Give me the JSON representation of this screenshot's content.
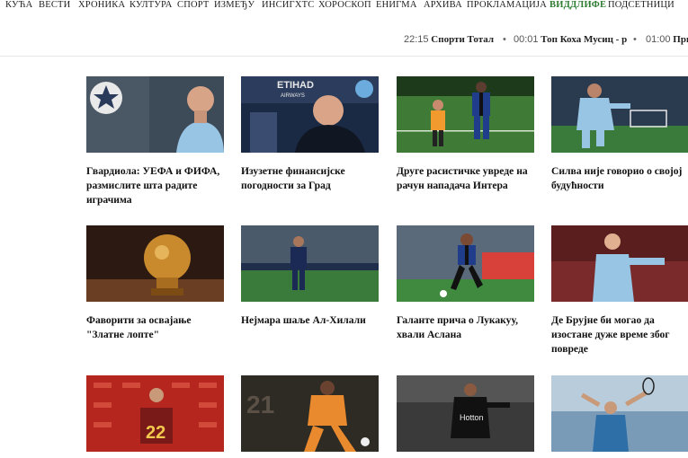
{
  "nav": {
    "items": [
      {
        "label": "КУЋА",
        "accent": false
      },
      {
        "label": "ВЕСТИ",
        "accent": false
      },
      {
        "label": "ХРОНИКА",
        "accent": false
      },
      {
        "label": "КУЛТУРА",
        "accent": false
      },
      {
        "label": "СПОРТ",
        "accent": false
      },
      {
        "label": "ИЗМЕЂУ",
        "accent": false
      },
      {
        "label": "ИНСИГХТС",
        "accent": false
      },
      {
        "label": "ХОРОСКОП",
        "accent": false
      },
      {
        "label": "ЕНИГМА",
        "accent": false
      },
      {
        "label": "АРХИВА",
        "accent": false
      },
      {
        "label": "ПРОКЛАМАЦИЈА",
        "accent": false
      },
      {
        "label": "ВИДДЛИФЕ",
        "accent": true
      },
      {
        "label": "ПОДСЕТНИЦИ",
        "accent": false
      }
    ]
  },
  "ticker": {
    "items": [
      {
        "time": "22:15",
        "title": "Спорти Тотал"
      },
      {
        "time": "00:01",
        "title": "Топ Коха Мусиц - р"
      },
      {
        "time": "01:00",
        "title": "При"
      }
    ],
    "separator": "•"
  },
  "articles": [
    {
      "caption": "Гвардиола: УЕФА и ФИФА, размислите шта радите играчима"
    },
    {
      "caption": "Изузетне финансијске погодности за Град",
      "image_text": [
        "ETIHAD",
        "AIRWAYS"
      ]
    },
    {
      "caption": "Друге расистичке увреде на рачун нападача Интера"
    },
    {
      "caption": "Силва није говорио о својој будућности"
    },
    {
      "caption": "Фаворити за освајање \"Златне лопте\""
    },
    {
      "caption": "Нејмара шаље Ал-Хилали"
    },
    {
      "caption": "Галанте прича о Лукакуу, хвали Аслана"
    },
    {
      "caption": "Де Брујне би могао да изостане дуже време због повреде"
    },
    {
      "caption": "",
      "image_text": [
        "22"
      ]
    },
    {
      "caption": "",
      "image_text": [
        "21"
      ]
    },
    {
      "caption": "",
      "image_text": [
        "Hotton"
      ]
    },
    {
      "caption": ""
    }
  ]
}
